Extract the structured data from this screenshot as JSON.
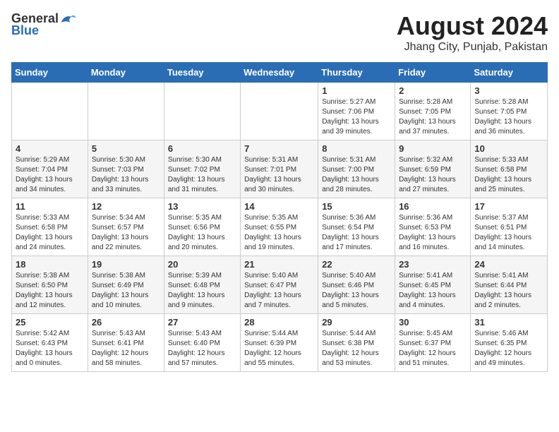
{
  "header": {
    "logo": {
      "general": "General",
      "blue": "Blue"
    },
    "title": "August 2024",
    "location": "Jhang City, Punjab, Pakistan"
  },
  "weekdays": [
    "Sunday",
    "Monday",
    "Tuesday",
    "Wednesday",
    "Thursday",
    "Friday",
    "Saturday"
  ],
  "weeks": [
    [
      {
        "day": "",
        "info": ""
      },
      {
        "day": "",
        "info": ""
      },
      {
        "day": "",
        "info": ""
      },
      {
        "day": "",
        "info": ""
      },
      {
        "day": "1",
        "info": "Sunrise: 5:27 AM\nSunset: 7:06 PM\nDaylight: 13 hours\nand 39 minutes."
      },
      {
        "day": "2",
        "info": "Sunrise: 5:28 AM\nSunset: 7:05 PM\nDaylight: 13 hours\nand 37 minutes."
      },
      {
        "day": "3",
        "info": "Sunrise: 5:28 AM\nSunset: 7:05 PM\nDaylight: 13 hours\nand 36 minutes."
      }
    ],
    [
      {
        "day": "4",
        "info": "Sunrise: 5:29 AM\nSunset: 7:04 PM\nDaylight: 13 hours\nand 34 minutes."
      },
      {
        "day": "5",
        "info": "Sunrise: 5:30 AM\nSunset: 7:03 PM\nDaylight: 13 hours\nand 33 minutes."
      },
      {
        "day": "6",
        "info": "Sunrise: 5:30 AM\nSunset: 7:02 PM\nDaylight: 13 hours\nand 31 minutes."
      },
      {
        "day": "7",
        "info": "Sunrise: 5:31 AM\nSunset: 7:01 PM\nDaylight: 13 hours\nand 30 minutes."
      },
      {
        "day": "8",
        "info": "Sunrise: 5:31 AM\nSunset: 7:00 PM\nDaylight: 13 hours\nand 28 minutes."
      },
      {
        "day": "9",
        "info": "Sunrise: 5:32 AM\nSunset: 6:59 PM\nDaylight: 13 hours\nand 27 minutes."
      },
      {
        "day": "10",
        "info": "Sunrise: 5:33 AM\nSunset: 6:58 PM\nDaylight: 13 hours\nand 25 minutes."
      }
    ],
    [
      {
        "day": "11",
        "info": "Sunrise: 5:33 AM\nSunset: 6:58 PM\nDaylight: 13 hours\nand 24 minutes."
      },
      {
        "day": "12",
        "info": "Sunrise: 5:34 AM\nSunset: 6:57 PM\nDaylight: 13 hours\nand 22 minutes."
      },
      {
        "day": "13",
        "info": "Sunrise: 5:35 AM\nSunset: 6:56 PM\nDaylight: 13 hours\nand 20 minutes."
      },
      {
        "day": "14",
        "info": "Sunrise: 5:35 AM\nSunset: 6:55 PM\nDaylight: 13 hours\nand 19 minutes."
      },
      {
        "day": "15",
        "info": "Sunrise: 5:36 AM\nSunset: 6:54 PM\nDaylight: 13 hours\nand 17 minutes."
      },
      {
        "day": "16",
        "info": "Sunrise: 5:36 AM\nSunset: 6:53 PM\nDaylight: 13 hours\nand 16 minutes."
      },
      {
        "day": "17",
        "info": "Sunrise: 5:37 AM\nSunset: 6:51 PM\nDaylight: 13 hours\nand 14 minutes."
      }
    ],
    [
      {
        "day": "18",
        "info": "Sunrise: 5:38 AM\nSunset: 6:50 PM\nDaylight: 13 hours\nand 12 minutes."
      },
      {
        "day": "19",
        "info": "Sunrise: 5:38 AM\nSunset: 6:49 PM\nDaylight: 13 hours\nand 10 minutes."
      },
      {
        "day": "20",
        "info": "Sunrise: 5:39 AM\nSunset: 6:48 PM\nDaylight: 13 hours\nand 9 minutes."
      },
      {
        "day": "21",
        "info": "Sunrise: 5:40 AM\nSunset: 6:47 PM\nDaylight: 13 hours\nand 7 minutes."
      },
      {
        "day": "22",
        "info": "Sunrise: 5:40 AM\nSunset: 6:46 PM\nDaylight: 13 hours\nand 5 minutes."
      },
      {
        "day": "23",
        "info": "Sunrise: 5:41 AM\nSunset: 6:45 PM\nDaylight: 13 hours\nand 4 minutes."
      },
      {
        "day": "24",
        "info": "Sunrise: 5:41 AM\nSunset: 6:44 PM\nDaylight: 13 hours\nand 2 minutes."
      }
    ],
    [
      {
        "day": "25",
        "info": "Sunrise: 5:42 AM\nSunset: 6:43 PM\nDaylight: 13 hours\nand 0 minutes."
      },
      {
        "day": "26",
        "info": "Sunrise: 5:43 AM\nSunset: 6:41 PM\nDaylight: 12 hours\nand 58 minutes."
      },
      {
        "day": "27",
        "info": "Sunrise: 5:43 AM\nSunset: 6:40 PM\nDaylight: 12 hours\nand 57 minutes."
      },
      {
        "day": "28",
        "info": "Sunrise: 5:44 AM\nSunset: 6:39 PM\nDaylight: 12 hours\nand 55 minutes."
      },
      {
        "day": "29",
        "info": "Sunrise: 5:44 AM\nSunset: 6:38 PM\nDaylight: 12 hours\nand 53 minutes."
      },
      {
        "day": "30",
        "info": "Sunrise: 5:45 AM\nSunset: 6:37 PM\nDaylight: 12 hours\nand 51 minutes."
      },
      {
        "day": "31",
        "info": "Sunrise: 5:46 AM\nSunset: 6:35 PM\nDaylight: 12 hours\nand 49 minutes."
      }
    ]
  ]
}
